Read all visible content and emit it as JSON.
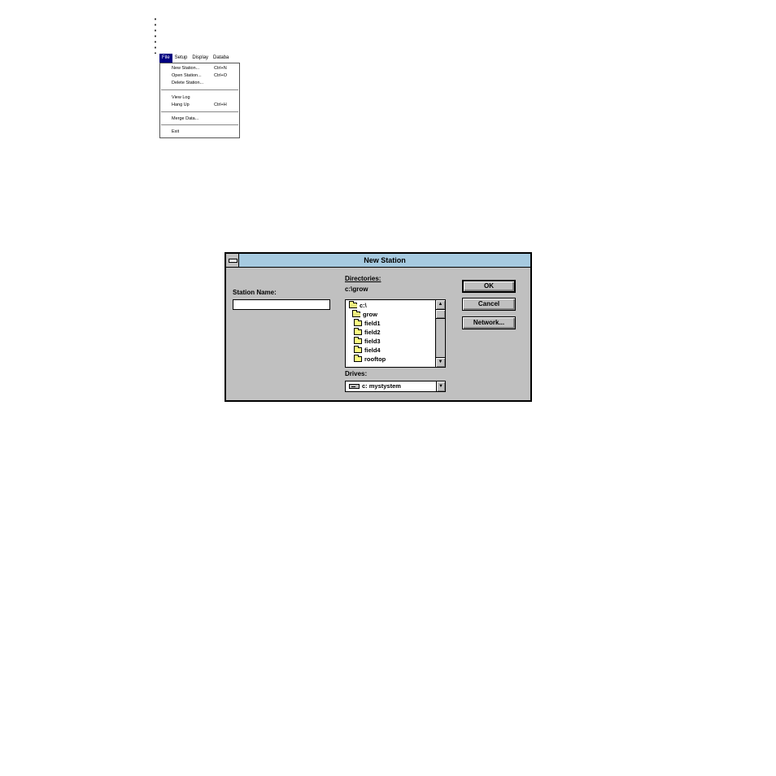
{
  "menu": {
    "bar": [
      "File",
      "Setup",
      "Display",
      "Databa"
    ],
    "items": [
      {
        "label": "New Station...",
        "accel": "Ctrl+N"
      },
      {
        "label": "Open Station...",
        "accel": "Ctrl+O"
      },
      {
        "label": "Delete Station...",
        "accel": ""
      },
      {
        "label": "View Log",
        "accel": ""
      },
      {
        "label": "Hang Up",
        "accel": "Ctrl+H"
      },
      {
        "label": "Merge Data...",
        "accel": ""
      },
      {
        "label": "Exit",
        "accel": ""
      }
    ]
  },
  "dialog": {
    "title": "New Station",
    "station_name_label": "Station Name:",
    "station_name_value": "",
    "directories_label": "Directories:",
    "current_path": "c:\\grow",
    "directories": [
      "c:\\",
      "grow",
      "field1",
      "field2",
      "field3",
      "field4",
      "rooftop"
    ],
    "drives_label": "Drives:",
    "drive_value": "c: mystystem",
    "buttons": {
      "ok": "OK",
      "cancel": "Cancel",
      "network": "Network..."
    }
  }
}
